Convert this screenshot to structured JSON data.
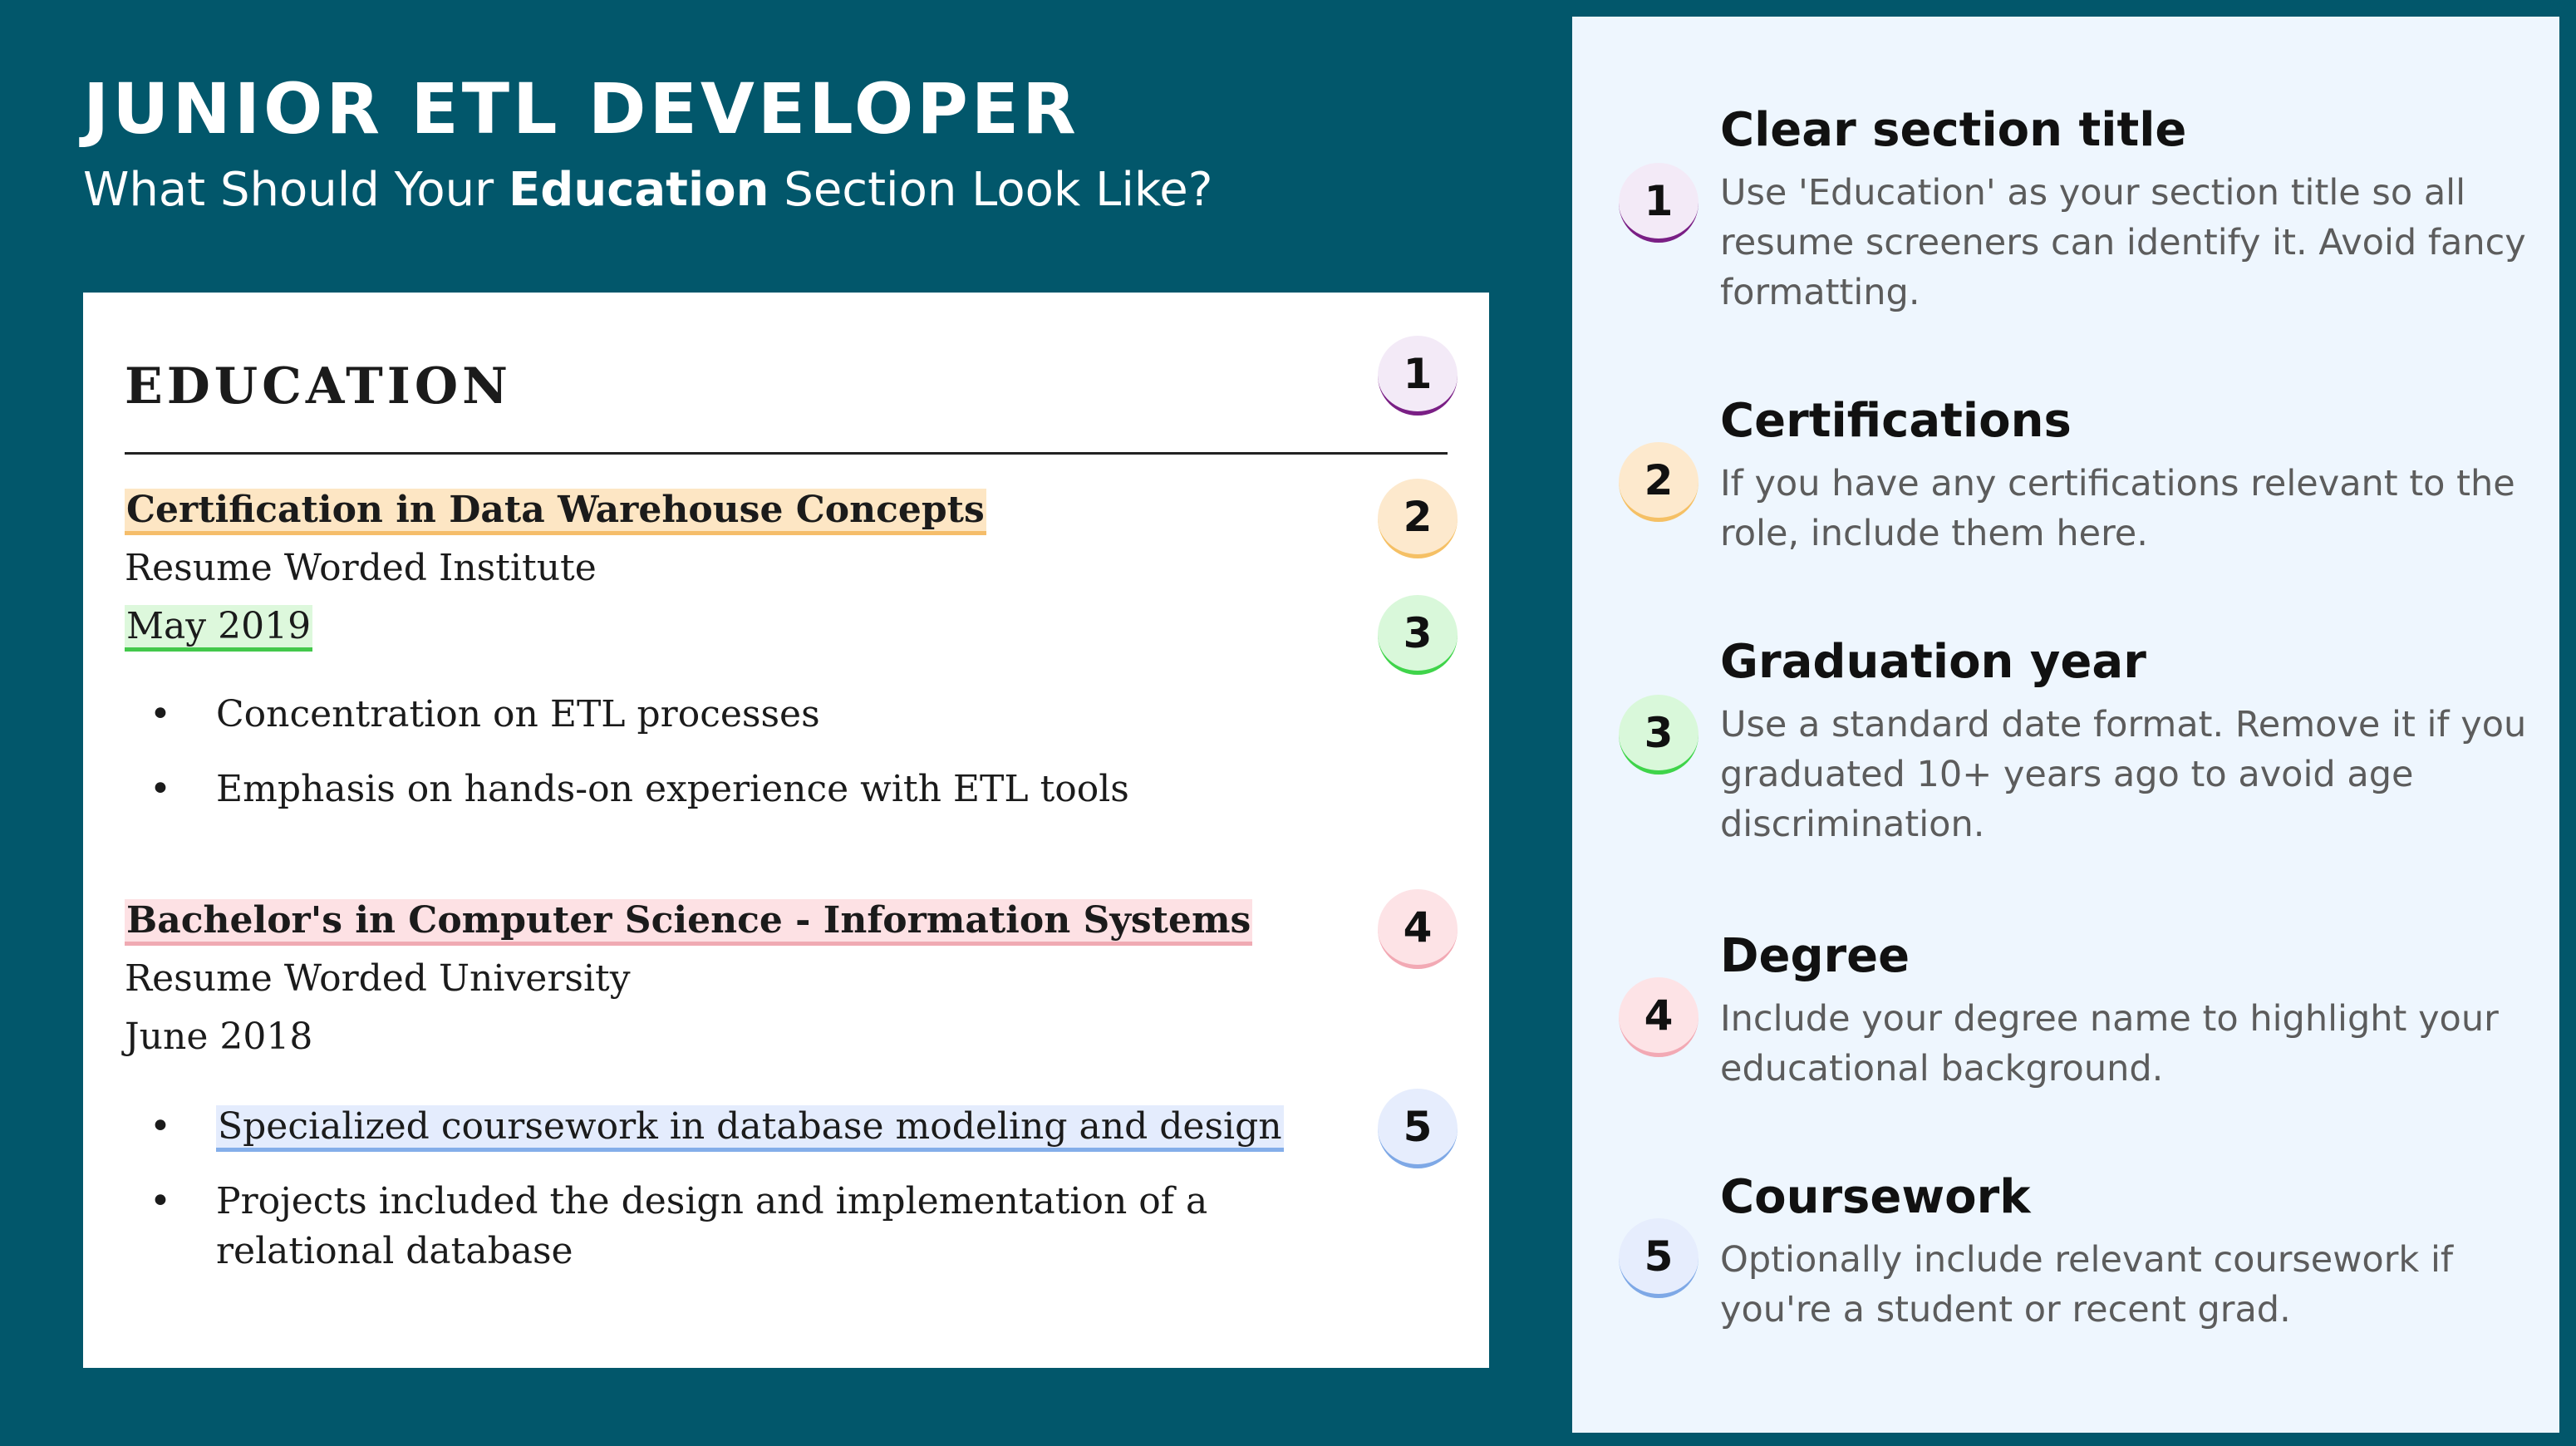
{
  "header": {
    "title": "JUNIOR ETL DEVELOPER",
    "subtitle_pre": "What Should Your ",
    "subtitle_bold": "Education",
    "subtitle_post": " Section Look Like?"
  },
  "resume": {
    "section_heading": "EDUCATION",
    "entries": [
      {
        "degree": "Certification in Data Warehouse Concepts",
        "institution": "Resume Worded Institute",
        "date": "May 2019",
        "bullets": [
          "Concentration on ETL processes",
          "Emphasis on hands-on experience with ETL tools"
        ]
      },
      {
        "degree": "Bachelor's in Computer Science - Information Systems",
        "institution": "Resume Worded University",
        "date": "June 2018",
        "bullets": [
          "Specialized coursework in database modeling and design",
          "Projects included the design and implementation of a relational database"
        ]
      }
    ],
    "bullet_symbol": "•"
  },
  "badges": [
    "1",
    "2",
    "3",
    "4",
    "5"
  ],
  "tips": [
    {
      "number": "1",
      "title": "Clear section title",
      "body": "Use 'Education' as your section title so all resume screeners can identify it. Avoid fancy formatting."
    },
    {
      "number": "2",
      "title": "Certifications",
      "body": "If you have any certifications relevant to the role, include them here."
    },
    {
      "number": "3",
      "title": "Graduation year",
      "body": "Use a standard date format. Remove it if you graduated 10+ years ago to avoid age discrimination."
    },
    {
      "number": "4",
      "title": "Degree",
      "body": "Include your degree name to highlight your educational background."
    },
    {
      "number": "5",
      "title": "Coursework",
      "body": "Optionally include relevant coursework if you're a student or recent grad."
    }
  ],
  "colors": {
    "background": "#02576b",
    "panel": "#eef6fe",
    "badge_1": "#7a1f85",
    "badge_2": "#f5c065",
    "badge_3": "#3fd44a",
    "badge_4": "#f2a9b4",
    "badge_5": "#7ea8e6"
  }
}
